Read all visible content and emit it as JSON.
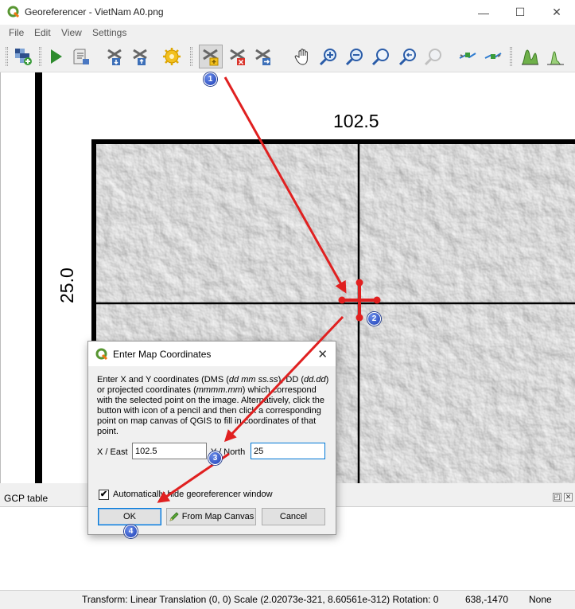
{
  "window": {
    "title": "Georeferencer - VietNam A0.png",
    "minimize": "—",
    "maximize": "☐",
    "close": "✕"
  },
  "menu": [
    "File",
    "Edit",
    "View",
    "Settings"
  ],
  "toolbar": {
    "items": [
      "open-raster",
      "start-georeferencing",
      "generate-gdal-script",
      "load-gcp-points",
      "save-gcp-points",
      "transformation-settings",
      "add-point",
      "delete-point",
      "move-gcp-point",
      "pan",
      "zoom-in",
      "zoom-out",
      "zoom-to-layer",
      "zoom-last",
      "zoom-next",
      "link-georeferencer-to-qgis",
      "link-qgis-to-georeferencer",
      "full-histogram-stretch",
      "local-histogram-stretch"
    ],
    "active": "add-point"
  },
  "canvas": {
    "lon_label": "102.5",
    "lat_label": "25.0"
  },
  "dialog": {
    "title": "Enter Map Coordinates",
    "close": "✕",
    "instr_1": "Enter X and Y coordinates (DMS (",
    "instr_dms": "dd mm ss.ss",
    "instr_2": "), DD (",
    "instr_dd": "dd.dd",
    "instr_3": ") or projected coordinates (",
    "instr_proj": "mmmm.mm",
    "instr_4": ") which correspond with the selected point on the image. Alternatively, click the button with icon of a pencil and then click a corresponding point on map canvas of QGIS to fill in coordinates of that point.",
    "x_label": "X / East",
    "x_value": "102.5",
    "y_label": "Y / North",
    "y_value": "25",
    "auto_hide_label": "Automatically hide georeferencer window",
    "auto_hide_checked": "✔",
    "ok": "OK",
    "from_canvas": "From Map Canvas",
    "cancel": "Cancel"
  },
  "gcp_table": {
    "title": "GCP table",
    "float_btn": "◰",
    "close_btn": "✕"
  },
  "status": {
    "transform": "Transform: Linear Translation (0, 0) Scale (2.02073e-321, 8.60561e-312) Rotation: 0",
    "coords": "638,-1470",
    "crs": "None"
  },
  "callouts": [
    "1",
    "2",
    "3",
    "4"
  ],
  "colors": {
    "arrow": "#e02020",
    "badge": "#2f55d4",
    "accent": "#0078d7"
  }
}
